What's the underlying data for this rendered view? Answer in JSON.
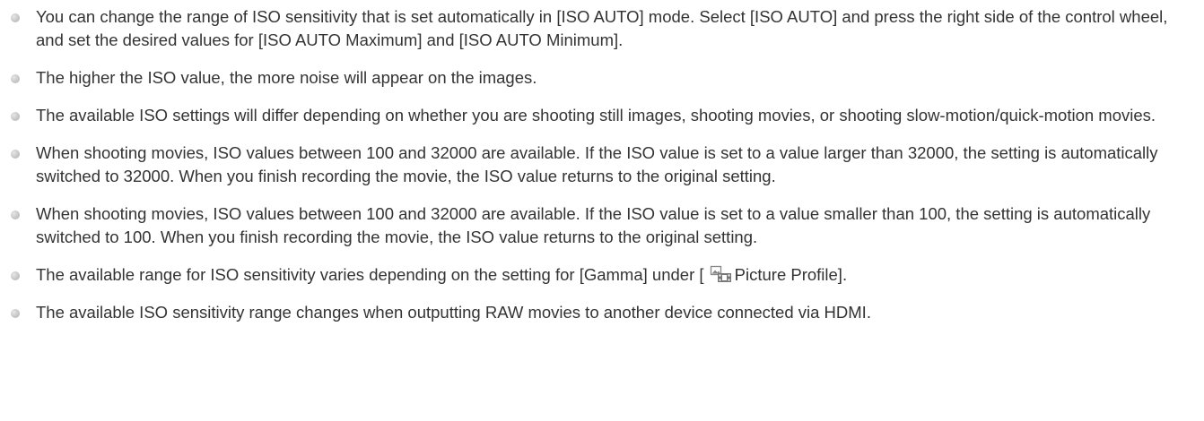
{
  "notes": [
    {
      "text": "You can change the range of ISO sensitivity that is set automatically in [ISO AUTO] mode. Select [ISO AUTO] and press the right side of the control wheel, and set the desired values for [ISO AUTO Maximum] and [ISO AUTO Minimum]."
    },
    {
      "text": "The higher the ISO value, the more noise will appear on the images."
    },
    {
      "text": "The available ISO settings will differ depending on whether you are shooting still images, shooting movies, or shooting slow-motion/quick-motion movies."
    },
    {
      "text": "When shooting movies, ISO values between 100 and 32000 are available. If the ISO value is set to a value larger than 32000, the setting is automatically switched to 32000. When you finish recording the movie, the ISO value returns to the original setting."
    },
    {
      "text": "When shooting movies, ISO values between 100 and 32000 are available. If the ISO value is set to a value smaller than 100, the setting is automatically switched to 100. When you finish recording the movie, the ISO value returns to the original setting."
    },
    {
      "text_before": "The available range for ISO sensitivity varies depending on the setting for [Gamma] under [ ",
      "icon": "movie-picture-profile-icon",
      "text_after": "Picture Profile]."
    },
    {
      "text": "The available ISO sensitivity range changes when outputting RAW movies to another device connected via HDMI."
    }
  ],
  "colors": {
    "text": "#333333",
    "bullet": "#c4c4c4"
  }
}
